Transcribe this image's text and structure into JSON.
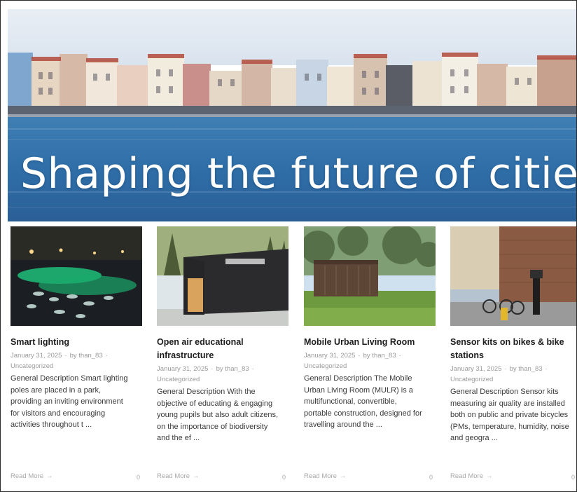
{
  "hero": {
    "title": "Shaping the future of cities"
  },
  "posts": [
    {
      "title_lines": [
        "Smart lighting"
      ],
      "date": "January 31, 2025",
      "author": "by than_83",
      "category": "Uncategorized",
      "excerpt_lines": [
        "General Description Smart lighting",
        "poles are placed in a park,",
        "providing an inviting environment",
        "for visitors and encouraging",
        "activities throughout t ..."
      ],
      "read_more": "Read More",
      "arrow": "→",
      "comments": "0",
      "thumb_icon": "night-park-lighting-image"
    },
    {
      "title_lines": [
        "Open air educational",
        "infrastructure"
      ],
      "date": "January 31, 2025",
      "author": "by than_83",
      "category": "Uncategorized",
      "excerpt_lines": [
        "General Description With the",
        "objective of educating & engaging",
        "young pupils but also adult citizens,",
        "on the importance of biodiversity",
        "and the ef ..."
      ],
      "read_more": "Read More",
      "arrow": "→",
      "comments": "0",
      "thumb_icon": "wooden-pavilion-image"
    },
    {
      "title_lines": [
        "Mobile Urban Living Room"
      ],
      "date": "January 31, 2025",
      "author": "by than_83",
      "category": "Uncategorized",
      "excerpt_lines": [
        "General Description The Mobile",
        "Urban Living Room (MULR) is a",
        "multifunctional, convertible,",
        "portable construction, designed for",
        "travelling around the ..."
      ],
      "read_more": "Read More",
      "arrow": "→",
      "comments": "0",
      "thumb_icon": "park-kiosk-image"
    },
    {
      "title_lines": [
        "Sensor kits on bikes & bike",
        "stations"
      ],
      "date": "January 31, 2025",
      "author": "by than_83",
      "category": "Uncategorized",
      "excerpt_lines": [
        "General Description Sensor kits",
        "measuring air quality are installed",
        "both on public and private bicycles",
        "(PMs, temperature, humidity, noise",
        "and geogra ..."
      ],
      "read_more": "Read More",
      "arrow": "→",
      "comments": "0",
      "thumb_icon": "bike-station-image"
    }
  ]
}
